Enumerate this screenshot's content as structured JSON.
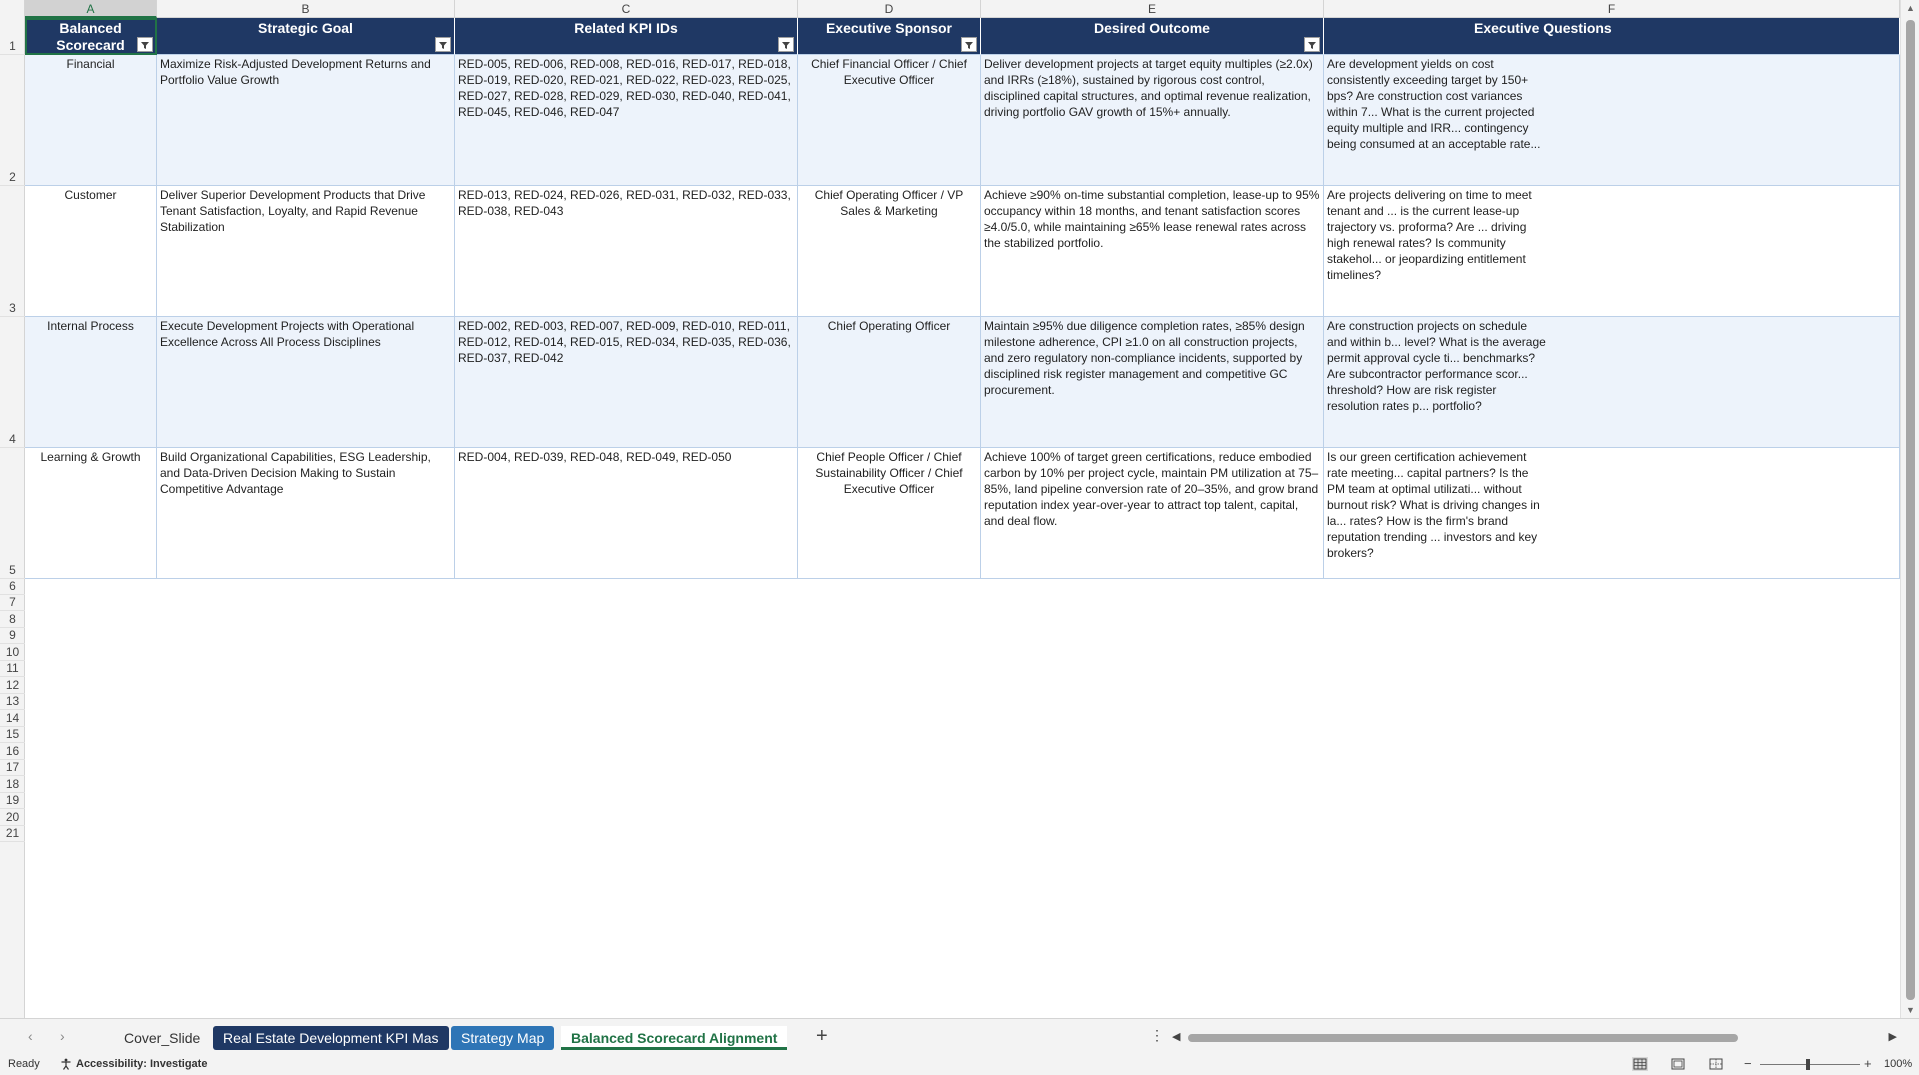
{
  "columns": [
    "A",
    "B",
    "C",
    "D",
    "E",
    "F"
  ],
  "rows": [
    "1",
    "2",
    "3",
    "4",
    "5",
    "6",
    "7",
    "8",
    "9",
    "10",
    "11",
    "12",
    "13",
    "14",
    "15",
    "16",
    "17",
    "18",
    "19",
    "20",
    "21"
  ],
  "table": {
    "headers": [
      "Balanced Scorecard Perspective",
      "Strategic Goal",
      "Related KPI IDs",
      "Executive Sponsor",
      "Desired Outcome",
      "Executive Questions"
    ],
    "rows": [
      {
        "perspective": "Financial",
        "goal": "Maximize Risk-Adjusted Development Returns and Portfolio Value Growth",
        "kpis": "RED-005, RED-006, RED-008, RED-016, RED-017, RED-018, RED-019, RED-020, RED-021, RED-022, RED-023, RED-025, RED-027, RED-028, RED-029, RED-030, RED-040, RED-041, RED-045, RED-046, RED-047",
        "sponsor": "Chief Financial Officer / Chief Executive Officer",
        "outcome": "Deliver development projects at target equity multiples (≥2.0x) and IRRs (≥18%), sustained by rigorous cost control, disciplined capital structures, and optimal revenue realization, driving portfolio GAV growth of 15%+ annually.",
        "questions": "Are development yields on cost consistently exceeding target by 150+ bps? Are construction cost variances within 7... What is the current projected equity multiple and IRR... contingency being consumed at an acceptable rate..."
      },
      {
        "perspective": "Customer",
        "goal": "Deliver Superior Development Products that Drive Tenant Satisfaction, Loyalty, and Rapid Revenue Stabilization",
        "kpis": "RED-013, RED-024, RED-026, RED-031, RED-032, RED-033, RED-038, RED-043",
        "sponsor": "Chief Operating Officer / VP Sales & Marketing",
        "outcome": "Achieve ≥90% on-time substantial completion, lease-up to 95% occupancy within 18 months, and tenant satisfaction scores ≥4.0/5.0, while maintaining ≥65% lease renewal rates across the stabilized portfolio.",
        "questions": "Are projects delivering on time to meet tenant and ... is the current lease-up trajectory vs. proforma? Are ... driving high renewal rates? Is community stakehol... or jeopardizing entitlement timelines?"
      },
      {
        "perspective": "Internal Process",
        "goal": "Execute Development Projects with Operational Excellence Across All Process Disciplines",
        "kpis": "RED-002, RED-003, RED-007, RED-009, RED-010, RED-011, RED-012, RED-014, RED-015, RED-034, RED-035, RED-036, RED-037, RED-042",
        "sponsor": "Chief Operating Officer",
        "outcome": "Maintain ≥95% due diligence completion rates, ≥85% design milestone adherence, CPI ≥1.0 on all construction projects, and zero regulatory non-compliance incidents, supported by disciplined risk register management and competitive GC procurement.",
        "questions": "Are construction projects on schedule and within b... level? What is the average permit approval cycle ti... benchmarks? Are subcontractor performance scor... threshold? How are risk register resolution rates p... portfolio?"
      },
      {
        "perspective": "Learning & Growth",
        "goal": "Build Organizational Capabilities, ESG Leadership, and Data-Driven Decision Making to Sustain Competitive Advantage",
        "kpis": "RED-004, RED-039, RED-048, RED-049, RED-050",
        "sponsor": "Chief People Officer / Chief Sustainability Officer / Chief Executive Officer",
        "outcome": "Achieve 100% of target green certifications, reduce embodied carbon by 10% per project cycle, maintain PM utilization at 75–85%, land pipeline conversion rate of 20–35%, and grow brand reputation index year-over-year to attract top talent, capital, and deal flow.",
        "questions": "Is our green certification achievement rate meeting... capital partners? Is the PM team at optimal utilizati... without burnout risk? What is driving changes in la... rates? How is the firm's brand reputation trending ... investors and key brokers?"
      }
    ]
  },
  "sheet_tabs": [
    {
      "label": "Cover_Slide",
      "style": "plain"
    },
    {
      "label": "Real Estate Development KPI Mas",
      "style": "navy"
    },
    {
      "label": "Strategy Map",
      "style": "blue"
    },
    {
      "label": "Balanced Scorecard Alignment",
      "style": "active"
    }
  ],
  "status": {
    "ready": "Ready",
    "accessibility": "Accessibility: Investigate",
    "zoom": "100%"
  },
  "colors": {
    "header_bg": "#1f3864",
    "band_bg": "#edf3fb",
    "accent": "#217346",
    "tab_navy": "#1f3864",
    "tab_blue": "#2e75b6"
  },
  "icons": {
    "filter": "filter-dropdown-icon",
    "add_sheet": "plus-icon",
    "accessibility": "accessibility-icon"
  }
}
